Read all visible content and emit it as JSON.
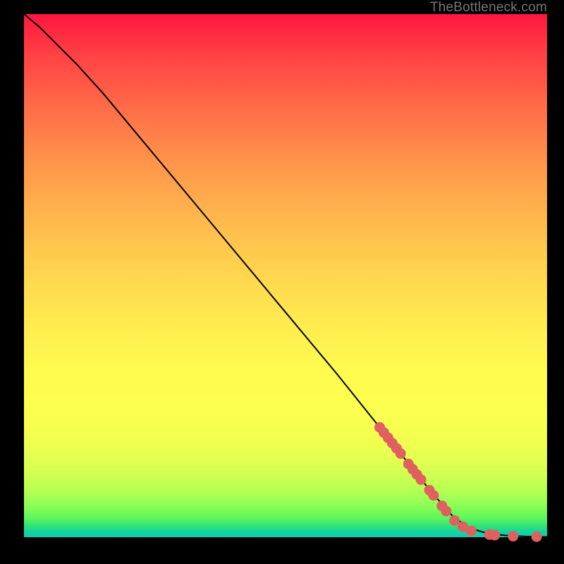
{
  "attribution": "TheBottleneck.com",
  "colors": {
    "curve": "#000000",
    "marker_fill": "#e06060",
    "marker_stroke": "#c24e4e"
  },
  "chart_data": {
    "type": "line",
    "title": "",
    "xlabel": "",
    "ylabel": "",
    "xlim": [
      0,
      100
    ],
    "ylim": [
      0,
      100
    ],
    "series": [
      {
        "name": "curve",
        "x": [
          0,
          3,
          6,
          10,
          15,
          20,
          30,
          40,
          50,
          60,
          70,
          78,
          82,
          85,
          88,
          90,
          92,
          94,
          96,
          98,
          100
        ],
        "y": [
          100,
          97.5,
          94.5,
          90.5,
          85,
          79,
          67,
          55,
          43,
          31,
          18.5,
          8.5,
          4.0,
          1.8,
          0.9,
          0.55,
          0.35,
          0.22,
          0.14,
          0.08,
          0.05
        ]
      }
    ],
    "markers": [
      {
        "x": 68.0,
        "y": 21.0
      },
      {
        "x": 68.8,
        "y": 20.0
      },
      {
        "x": 69.6,
        "y": 19.0
      },
      {
        "x": 70.4,
        "y": 18.0
      },
      {
        "x": 71.2,
        "y": 17.0
      },
      {
        "x": 72.0,
        "y": 16.0
      },
      {
        "x": 73.5,
        "y": 14.0
      },
      {
        "x": 74.3,
        "y": 13.0
      },
      {
        "x": 75.1,
        "y": 12.0
      },
      {
        "x": 75.9,
        "y": 11.0
      },
      {
        "x": 77.5,
        "y": 9.0
      },
      {
        "x": 78.3,
        "y": 8.0
      },
      {
        "x": 79.9,
        "y": 6.0
      },
      {
        "x": 80.7,
        "y": 5.0
      },
      {
        "x": 82.3,
        "y": 3.2
      },
      {
        "x": 83.9,
        "y": 2.0
      },
      {
        "x": 85.5,
        "y": 1.2
      },
      {
        "x": 89.0,
        "y": 0.5
      },
      {
        "x": 90.0,
        "y": 0.4
      },
      {
        "x": 93.5,
        "y": 0.2
      },
      {
        "x": 98.0,
        "y": 0.1
      }
    ]
  }
}
